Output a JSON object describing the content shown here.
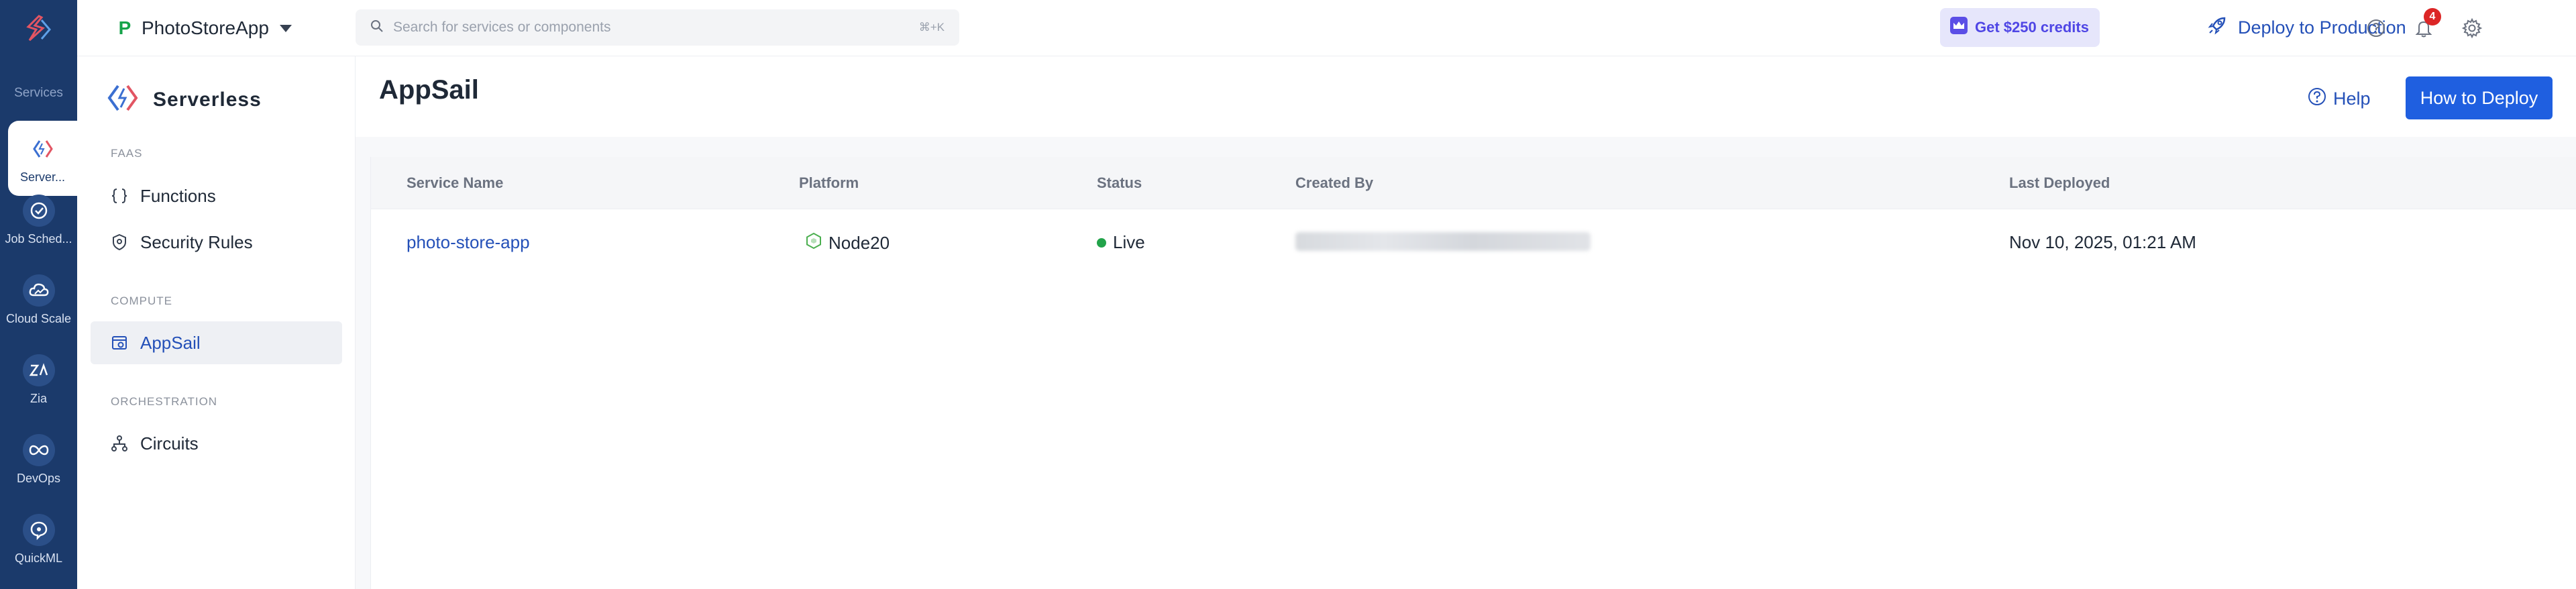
{
  "rail": {
    "services_label": "Services",
    "items": [
      {
        "label": "Server...",
        "icon": "serverless-icon"
      },
      {
        "label": "Job Sched...",
        "icon": "job-scheduling-icon"
      },
      {
        "label": "Cloud Scale",
        "icon": "cloud-scale-icon"
      },
      {
        "label": "Zia",
        "icon": "zia-icon"
      },
      {
        "label": "DevOps",
        "icon": "devops-icon"
      },
      {
        "label": "QuickML",
        "icon": "quickml-icon"
      }
    ]
  },
  "topbar": {
    "app_initial": "P",
    "app_name": "PhotoStoreApp",
    "search_placeholder": "Search for services or components",
    "search_shortcut": "⌘+K",
    "credits_label": "Get $250 credits",
    "deploy_label": "Deploy to Production",
    "notification_count": "4"
  },
  "sidenav": {
    "title": "Serverless",
    "sections": [
      {
        "label": "FAAS",
        "items": [
          {
            "label": "Functions",
            "icon": "braces-icon"
          },
          {
            "label": "Security Rules",
            "icon": "shield-icon"
          }
        ]
      },
      {
        "label": "COMPUTE",
        "items": [
          {
            "label": "AppSail",
            "icon": "appsail-icon",
            "active": true
          }
        ]
      },
      {
        "label": "ORCHESTRATION",
        "items": [
          {
            "label": "Circuits",
            "icon": "circuits-icon"
          }
        ]
      }
    ]
  },
  "main": {
    "title": "AppSail",
    "help_label": "Help",
    "how_to_deploy_label": "How to Deploy",
    "table": {
      "columns": [
        "Service Name",
        "Platform",
        "Status",
        "Created By",
        "Last Deployed"
      ],
      "rows": [
        {
          "service_name": "photo-store-app",
          "platform": "Node20",
          "status": "Live",
          "last_deployed": "Nov 10, 2025, 01:21 AM"
        }
      ]
    }
  },
  "colors": {
    "rail_bg": "#1b3a6b",
    "accent": "#1f5fe0",
    "link": "#2450b8",
    "status_live": "#22a34a",
    "credits_bg": "#e6e6fb"
  }
}
